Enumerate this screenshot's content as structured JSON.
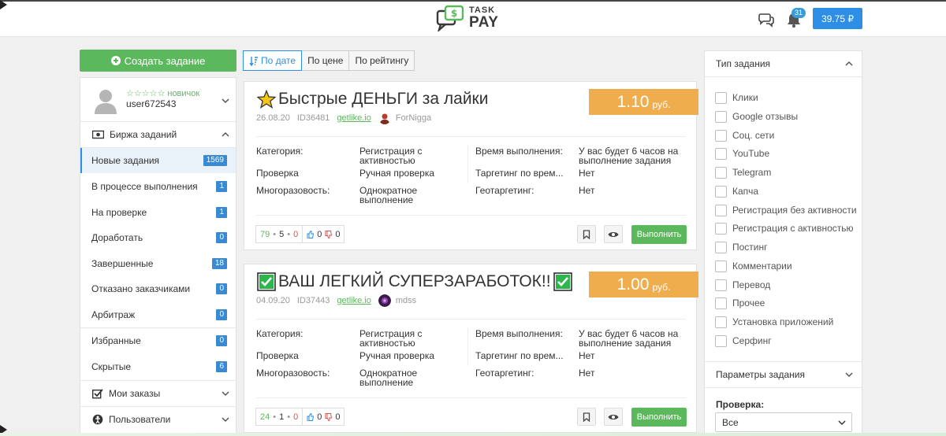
{
  "header": {
    "logo_top": "TASK",
    "logo_bottom": "PAY",
    "notifications_count": "31",
    "balance": "39.75 ₽"
  },
  "sidebar": {
    "create_button": "Создать задание",
    "user": {
      "rank": "☆☆☆☆☆ новичок",
      "name": "user672543"
    },
    "exchange_title": "Биржа заданий",
    "items": [
      {
        "label": "Новые задания",
        "count": "1569"
      },
      {
        "label": "В процессе выполнения",
        "count": "1"
      },
      {
        "label": "На проверке",
        "count": "1"
      },
      {
        "label": "Доработать",
        "count": "0"
      },
      {
        "label": "Завершенные",
        "count": "18"
      },
      {
        "label": "Отказано заказчиками",
        "count": "0"
      },
      {
        "label": "Арбитраж",
        "count": "0"
      },
      {
        "label": "Избранные",
        "count": "0"
      },
      {
        "label": "Скрытые",
        "count": "6"
      }
    ],
    "my_orders": "Мои заказы",
    "users": "Пользователи"
  },
  "sort": {
    "by_date": "По дате",
    "by_price": "По цене",
    "by_rating": "По рейтингу"
  },
  "labels": {
    "category": "Категория:",
    "check": "Проверка",
    "reusable": "Многоразовость:",
    "exec_time": "Время выполнения:",
    "time_targeting": "Таргетинг по врем...",
    "geo_targeting": "Геотаргетинг:",
    "do_button": "Выполнить"
  },
  "tasks": [
    {
      "icon": "star-icon",
      "title": "Быстрые ДЕНЬГИ за лайки",
      "price": "1.10",
      "currency": "руб.",
      "date": "26.08.20",
      "id": "ID36481",
      "site": "getlike.io",
      "author": "ForNigga",
      "category_l1": "Регистрация с",
      "category_l2": "активностью",
      "check": "Ручная проверка",
      "reuse_l1": "Однократное",
      "reuse_l2": "выполнение",
      "time_l1": "У вас будет 6 часов на",
      "time_l2": "выполнение задания",
      "time_targeting": "Нет",
      "geo": "Нет",
      "stat_total": "79",
      "stat_ok": "5",
      "stat_fail": "0",
      "likes": "0",
      "dislikes": "0"
    },
    {
      "icon": "check-box-icon",
      "title": "ВАШ ЛЕГКИЙ СУПЕРЗАРАБОТОК!!",
      "price": "1.00",
      "currency": "руб.",
      "date": "04.09.20",
      "id": "ID37443",
      "site": "getlike.io",
      "author": "mdss",
      "category_l1": "Регистрация с",
      "category_l2": "активностью",
      "check": "Ручная проверка",
      "reuse_l1": "Однократное",
      "reuse_l2": "выполнение",
      "time_l1": "У вас будет 6 часов на",
      "time_l2": "выполнение задания",
      "time_targeting": "Нет",
      "geo": "Нет",
      "stat_total": "24",
      "stat_ok": "1",
      "stat_fail": "0",
      "likes": "0",
      "dislikes": "0"
    }
  ],
  "filters": {
    "type_title": "Тип задания",
    "types": [
      "Клики",
      "Google отзывы",
      "Соц. сети",
      "YouTube",
      "Telegram",
      "Капча",
      "Регистрация без активности",
      "Регистрация с активностью",
      "Постинг",
      "Комментарии",
      "Перевод",
      "Прочее",
      "Установка приложений",
      "Серфинг"
    ],
    "params_title": "Параметры задания",
    "check_label": "Проверка:",
    "check_value": "Все"
  },
  "colors": {
    "accent_blue": "#2e8de4",
    "green": "#5cb85c",
    "price_orange": "#f0ad4e"
  }
}
